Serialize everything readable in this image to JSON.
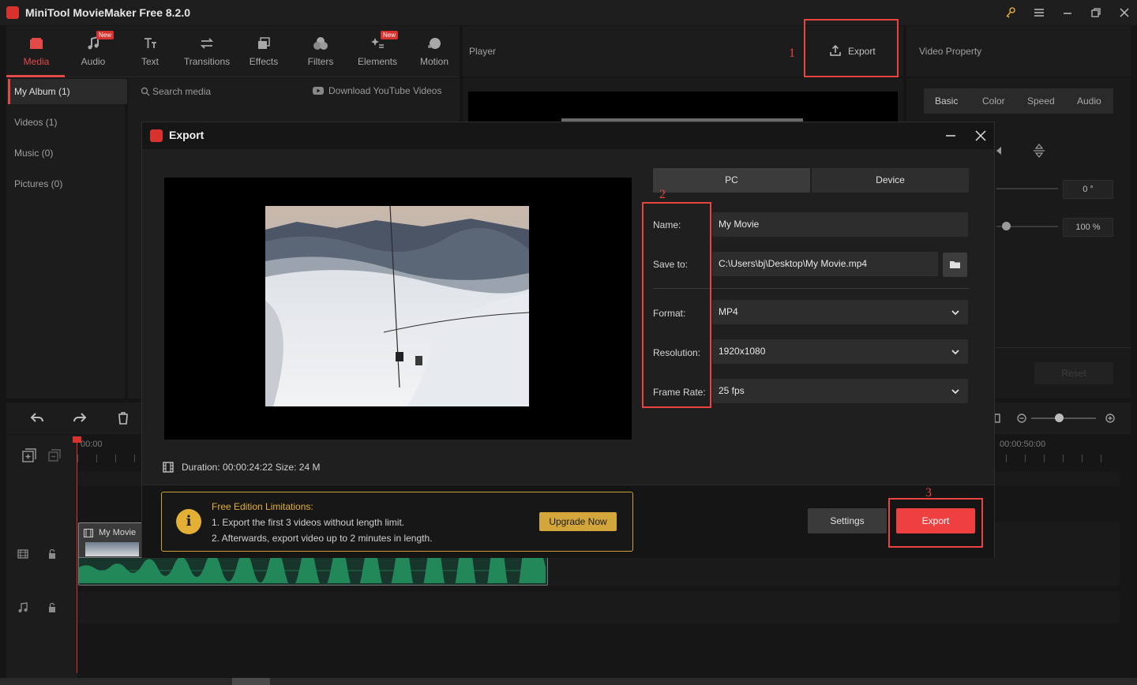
{
  "app": {
    "title": "MiniTool MovieMaker Free 8.2.0"
  },
  "media_tabs": [
    {
      "label": "Media",
      "icon": "media-icon",
      "active": true
    },
    {
      "label": "Audio",
      "icon": "music-note-icon",
      "badge": "New"
    },
    {
      "label": "Text",
      "icon": "text-icon"
    },
    {
      "label": "Transitions",
      "icon": "transitions-icon"
    },
    {
      "label": "Effects",
      "icon": "effects-icon"
    },
    {
      "label": "Filters",
      "icon": "filters-icon"
    },
    {
      "label": "Elements",
      "icon": "elements-icon",
      "badge": "New"
    },
    {
      "label": "Motion",
      "icon": "motion-icon"
    }
  ],
  "sidebar": [
    {
      "label": "My Album (1)",
      "active": true
    },
    {
      "label": "Videos (1)"
    },
    {
      "label": "Music (0)"
    },
    {
      "label": "Pictures (0)"
    }
  ],
  "media_main": {
    "search_placeholder": "Search media",
    "download_label": "Download YouTube Videos"
  },
  "player": {
    "title": "Player",
    "export_label": "Export"
  },
  "property": {
    "title": "Video Property",
    "tabs": [
      "Basic",
      "Color",
      "Speed",
      "Audio"
    ],
    "rotation_value": "0 °",
    "scale_value": "100 %",
    "reset_label": "Reset"
  },
  "timeline": {
    "start_time": "00:00",
    "end_time": "00:00:50:00",
    "clip_name": "My Movie"
  },
  "export_dialog": {
    "title": "Export",
    "tabs": [
      "PC",
      "Device"
    ],
    "active_tab": "PC",
    "fields": {
      "name_label": "Name:",
      "name_value": "My Movie",
      "save_label": "Save to:",
      "save_value": "C:\\Users\\bj\\Desktop\\My Movie.mp4",
      "format_label": "Format:",
      "format_value": "MP4",
      "resolution_label": "Resolution:",
      "resolution_value": "1920x1080",
      "framerate_label": "Frame Rate:",
      "framerate_value": "25 fps"
    },
    "duration_text": "Duration:  00:00:24:22  Size:  24 M",
    "notice": {
      "title": "Free Edition Limitations:",
      "line1": "1. Export the first 3 videos without length limit.",
      "line2": "2. Afterwards, export video up to 2 minutes in length.",
      "upgrade_label": "Upgrade Now"
    },
    "settings_label": "Settings",
    "export_label": "Export"
  },
  "annotations": {
    "one": "1",
    "two": "2",
    "three": "3"
  },
  "colors": {
    "accent": "#ee4040",
    "annotation": "#e9443f",
    "notice": "#e3b035"
  }
}
